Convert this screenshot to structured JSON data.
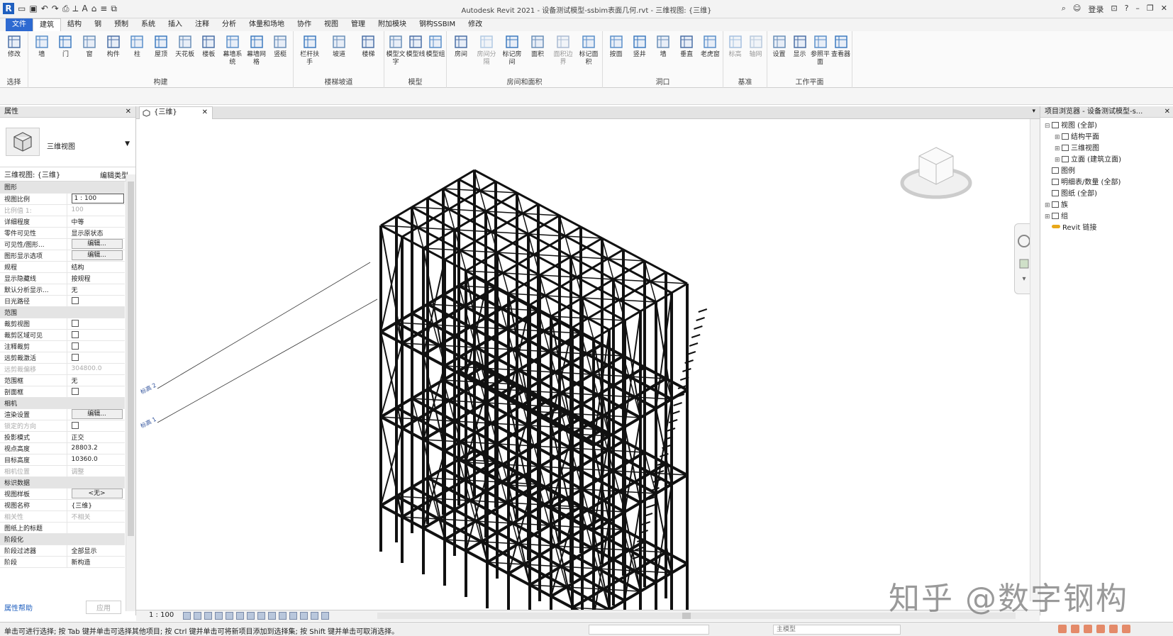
{
  "window": {
    "title": "Autodesk Revit 2021 - 设备测试模型-ssbim表面几何.rvt - 三维视图: {三维}",
    "sign_in": "登录",
    "help": "?"
  },
  "menu_tabs": [
    "文件",
    "建筑",
    "结构",
    "钢",
    "预制",
    "系统",
    "插入",
    "注释",
    "分析",
    "体量和场地",
    "协作",
    "视图",
    "管理",
    "附加模块",
    "钢构SSBIM",
    "修改"
  ],
  "ribbon": {
    "groups": [
      {
        "label": "选择",
        "buttons": [
          "修改"
        ]
      },
      {
        "label": "构建",
        "buttons": [
          "墙",
          "门",
          "窗",
          "构件",
          "柱",
          "屋顶",
          "天花板",
          "楼板",
          "幕墙系统",
          "幕墙网格",
          "竖梃"
        ]
      },
      {
        "label": "楼梯坡道",
        "buttons": [
          "栏杆扶手",
          "坡道",
          "楼梯"
        ]
      },
      {
        "label": "模型",
        "buttons": [
          "模型文字",
          "模型线",
          "模型组"
        ]
      },
      {
        "label": "房间和面积",
        "buttons": [
          "房间",
          "房间分隔",
          "标记房间",
          "面积",
          "面积边界",
          "标记面积"
        ]
      },
      {
        "label": "洞口",
        "buttons": [
          "按面",
          "竖井",
          "墙",
          "垂直",
          "老虎窗"
        ]
      },
      {
        "label": "基准",
        "buttons": [
          "标高",
          "轴网"
        ]
      },
      {
        "label": "工作平面",
        "buttons": [
          "设置",
          "显示",
          "参照平面",
          "查看器"
        ]
      }
    ]
  },
  "properties": {
    "title": "属性",
    "type_name": "三维视图",
    "filter": "三维视图: {三维}",
    "edit_type": "编辑类型",
    "sections": [
      {
        "name": "图形",
        "rows": [
          {
            "k": "视图比例",
            "v": "1 : 100",
            "kind": "input"
          },
          {
            "k": "比例值 1:",
            "v": "100",
            "kind": "dim"
          },
          {
            "k": "详细程度",
            "v": "中等"
          },
          {
            "k": "零件可见性",
            "v": "显示原状态"
          },
          {
            "k": "可见性/图形...",
            "v": "编辑...",
            "kind": "button"
          },
          {
            "k": "图形显示选项",
            "v": "编辑...",
            "kind": "button"
          },
          {
            "k": "规程",
            "v": "结构"
          },
          {
            "k": "显示隐藏线",
            "v": "按规程"
          },
          {
            "k": "默认分析显示...",
            "v": "无"
          },
          {
            "k": "日光路径",
            "v": "",
            "kind": "check"
          }
        ]
      },
      {
        "name": "范围",
        "rows": [
          {
            "k": "裁剪视图",
            "v": "",
            "kind": "check"
          },
          {
            "k": "裁剪区域可见",
            "v": "",
            "kind": "check"
          },
          {
            "k": "注释裁剪",
            "v": "",
            "kind": "check"
          },
          {
            "k": "远剪裁激活",
            "v": "",
            "kind": "check"
          },
          {
            "k": "远剪裁偏移",
            "v": "304800.0",
            "kind": "dim"
          },
          {
            "k": "范围框",
            "v": "无"
          },
          {
            "k": "剖面框",
            "v": "",
            "kind": "check"
          }
        ]
      },
      {
        "name": "相机",
        "rows": [
          {
            "k": "渲染设置",
            "v": "编辑...",
            "kind": "button"
          },
          {
            "k": "锁定的方向",
            "v": "",
            "kind": "dimcheck"
          },
          {
            "k": "投影模式",
            "v": "正交"
          },
          {
            "k": "视点高度",
            "v": "28803.2"
          },
          {
            "k": "目标高度",
            "v": "10360.0"
          },
          {
            "k": "相机位置",
            "v": "调整",
            "kind": "dim"
          }
        ]
      },
      {
        "name": "标识数据",
        "rows": [
          {
            "k": "视图样板",
            "v": "<无>",
            "kind": "button"
          },
          {
            "k": "视图名称",
            "v": "{三维}"
          },
          {
            "k": "相关性",
            "v": "不相关",
            "kind": "dim"
          },
          {
            "k": "图纸上的标题",
            "v": ""
          }
        ]
      },
      {
        "name": "阶段化",
        "rows": [
          {
            "k": "阶段过滤器",
            "v": "全部显示"
          },
          {
            "k": "阶段",
            "v": "新构造"
          }
        ]
      }
    ],
    "help_link": "属性帮助",
    "apply": "应用"
  },
  "view": {
    "tab_label": "{三维}",
    "scale": "1 : 100",
    "level_labels": [
      "标高 2",
      "标高 1"
    ]
  },
  "browser": {
    "title": "项目浏览器 - 设备测试模型-s...",
    "items": [
      {
        "label": "视图 (全部)",
        "level": 0,
        "exp": "⊟"
      },
      {
        "label": "结构平面",
        "level": 1,
        "exp": "⊞"
      },
      {
        "label": "三维视图",
        "level": 1,
        "exp": "⊞"
      },
      {
        "label": "立面 (建筑立面)",
        "level": 1,
        "exp": "⊞"
      },
      {
        "label": "图例",
        "level": 0,
        "exp": ""
      },
      {
        "label": "明细表/数量 (全部)",
        "level": 0,
        "exp": ""
      },
      {
        "label": "图纸 (全部)",
        "level": 0,
        "exp": ""
      },
      {
        "label": "族",
        "level": 0,
        "exp": "⊞"
      },
      {
        "label": "组",
        "level": 0,
        "exp": "⊞"
      },
      {
        "label": "Revit 链接",
        "level": 0,
        "exp": "",
        "link": true
      }
    ]
  },
  "status": {
    "message": "单击可进行选择; 按 Tab 键并单击可选择其他项目; 按 Ctrl 键并单击可将新项目添加到选择集; 按 Shift 键并单击可取消选择。",
    "model": "主模型"
  },
  "watermark": "知乎 @数字钢构",
  "colors": {
    "accent": "#2e6ad1",
    "structure": "#111111"
  }
}
